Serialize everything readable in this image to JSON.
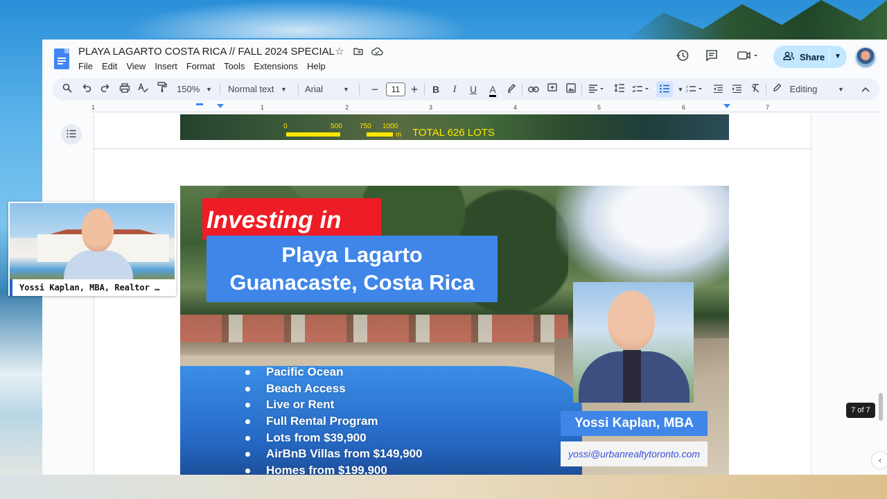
{
  "document": {
    "title": "PLAYA LAGARTO COSTA RICA // FALL 2024 SPECIAL"
  },
  "menu": [
    "File",
    "Edit",
    "View",
    "Insert",
    "Format",
    "Tools",
    "Extensions",
    "Help"
  ],
  "header": {
    "share_label": "Share"
  },
  "toolbar": {
    "zoom": "150%",
    "style": "Normal text",
    "font": "Arial",
    "font_size": "11",
    "bold": "B",
    "italic": "I",
    "underline": "U",
    "text_color_glyph": "A",
    "mode": "Editing"
  },
  "ruler": {
    "numbers": [
      "1",
      "1",
      "2",
      "3",
      "4",
      "5",
      "6",
      "7"
    ]
  },
  "map_image": {
    "scale_0": "0",
    "scale_500": "500",
    "scale_750": "750",
    "scale_1000": "1000",
    "scale_unit": "m",
    "total": "TOTAL 626 LOTS"
  },
  "flyer": {
    "heading": "Investing in",
    "place_line1": "Playa Lagarto",
    "place_line2": "Guanacaste, Costa Rica",
    "bullets": [
      "Pacific Ocean",
      "Beach Access",
      "Live or Rent",
      "Full Rental Program",
      "Lots from $39,900",
      "AirBnB Villas from $149,900",
      "Homes from $199,900"
    ],
    "agent_name": "Yossi Kaplan, MBA",
    "agent_email": "yossi@urbanrealtytoronto.com"
  },
  "page_indicator": "7 of 7",
  "webcam": {
    "label": "Yossi Kaplan, MBA, Realtor …"
  },
  "colors": {
    "accent_blue": "#3f86e8",
    "heading_red": "#ee1c25",
    "share_bg": "#c2e7ff",
    "map_yellow": "#ffe600"
  },
  "icons": [
    "docs-logo-icon",
    "star-icon",
    "folder-move-icon",
    "cloud-saved-icon",
    "history-icon",
    "comment-icon",
    "video-call-icon",
    "share-people-icon",
    "search-icon",
    "undo-icon",
    "redo-icon",
    "print-icon",
    "spellcheck-icon",
    "paint-format-icon",
    "link-icon",
    "add-comment-icon",
    "image-icon",
    "align-icon",
    "line-spacing-icon",
    "checklist-icon",
    "bulleted-list-icon",
    "numbered-list-icon",
    "decrease-indent-icon",
    "increase-indent-icon",
    "clear-formatting-icon",
    "pencil-icon",
    "collapse-icon",
    "outline-icon"
  ]
}
